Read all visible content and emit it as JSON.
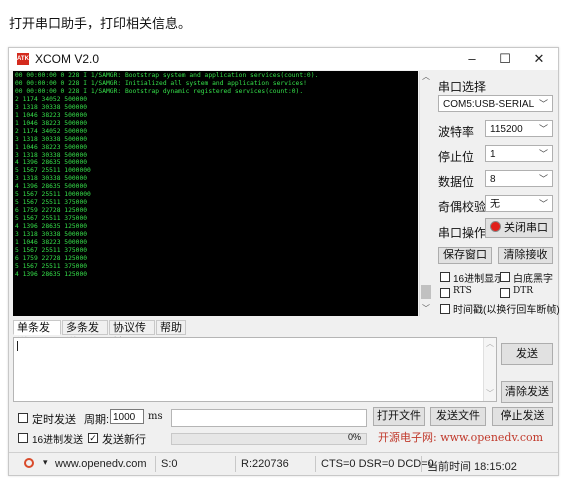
{
  "caption": "打开串口助手，打印相关信息。",
  "window": {
    "app_icon_text": "ATK",
    "title": "XCOM V2.0",
    "minimize": "–",
    "maximize": "☐",
    "close": "✕"
  },
  "terminal_lines": [
    "00 00:00:00 0 228 I 1/SAMGR: Bootstrap system and application services(count:0).",
    "00 00:00:00 0 228 I 1/SAMGR: Initialized all system and application services!",
    "00 00:00:00 0 228 I 1/SAMGR: Bootstrap dynamic registered services(count:0).",
    "2 1174 34052 500000",
    "3 1318 30338 500000",
    "1 1046 38223 500000",
    "1 1046 38223 500000",
    "2 1174 34052 500000",
    "3 1318 30338 500000",
    "1 1046 38223 500000",
    "3 1318 30338 500000",
    "4 1396 28635 500000",
    "5 1567 25511 1000000",
    "3 1318 30338 500000",
    "4 1396 28635 500000",
    "5 1567 25511 1000000",
    "5 1567 25511 375000",
    "6 1759 22728 125000",
    "5 1567 25511 375000",
    "4 1396 28635 125000",
    "3 1318 30338 500000",
    "1 1046 38223 500000",
    "5 1567 25511 375000",
    "6 1759 22728 125000",
    "5 1567 25511 375000",
    "4 1396 28635 125000"
  ],
  "panel": {
    "port_select_label": "串口选择",
    "port_value": "COM5:USB-SERIAL",
    "baud_label": "波特率",
    "baud_value": "115200",
    "stopbit_label": "停止位",
    "stopbit_value": "1",
    "databit_label": "数据位",
    "databit_value": "8",
    "parity_label": "奇偶校验",
    "parity_value": "无",
    "port_op_label": "串口操作",
    "close_port_button": "关闭串口",
    "save_window_button": "保存窗口",
    "clear_receive_button": "清除接收",
    "hex_display_label": "16进制显示",
    "white_black_label": "白底黑字",
    "rts_label": "RTS",
    "dtr_label": "DTR",
    "timestamp_label": "时间戳(以换行回车断帧)"
  },
  "tabs": [
    "单条发送",
    "多条发送",
    "协议传输",
    "帮助"
  ],
  "send": {
    "send_button": "发送",
    "clear_send_button": "清除发送",
    "timed_send_label": "定时发送",
    "period_label": "周期:",
    "period_value": "1000",
    "period_unit": "ms",
    "open_file_button": "打开文件",
    "send_file_button": "发送文件",
    "stop_send_button": "停止发送",
    "hex_send_label": "16进制发送",
    "send_newline_label": "发送新行",
    "progress_text": "0%",
    "progress_fraction": 0,
    "brand_text": "开源电子网: www.openedv.com"
  },
  "status": {
    "url": "www.openedv.com",
    "s": "S:0",
    "r": "R:220736",
    "lines": "CTS=0 DSR=0 DCD=0",
    "time": "当前时间 18:15:02"
  },
  "colors": {
    "terminal_bg": "#000000",
    "terminal_text": "#35e04a",
    "brand_text": "#c0392b",
    "close_indicator": "#e0201a"
  }
}
